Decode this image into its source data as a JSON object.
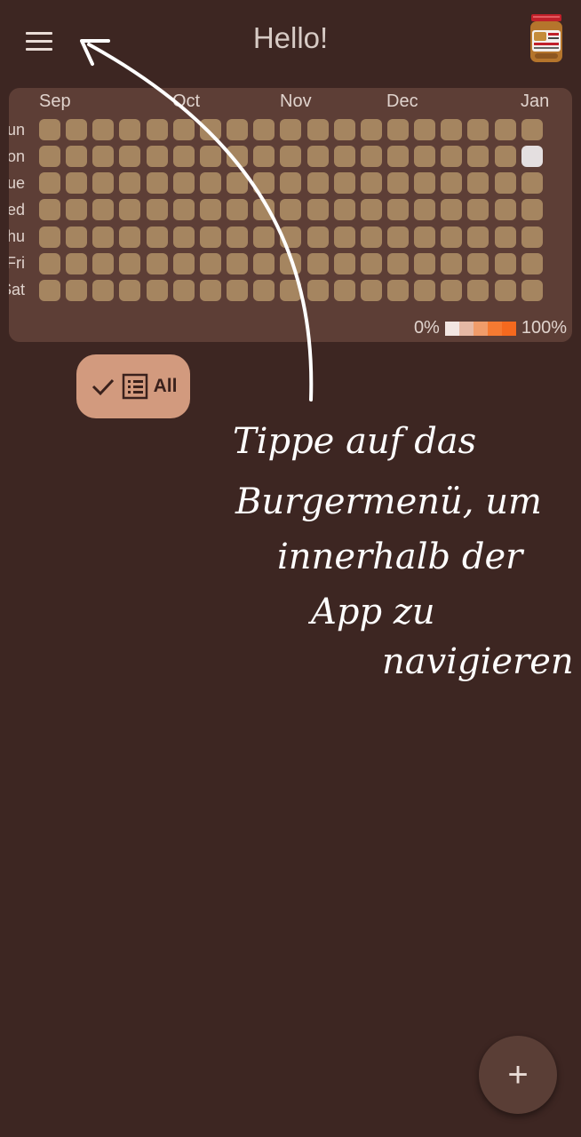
{
  "appbar": {
    "title": "Hello!",
    "menu_icon": "hamburger-menu-icon",
    "avatar_icon": "peanut-butter-jar-icon"
  },
  "heatmap": {
    "months": [
      "Sep",
      "Oct",
      "Nov",
      "Dec",
      "Jan"
    ],
    "weekdays": [
      "Sun",
      "Mon",
      "Tue",
      "Wed",
      "Thu",
      "Fri",
      "Sat"
    ],
    "highlighted_cell": {
      "weekday": "Mon",
      "month": "Jan"
    },
    "legend": {
      "min_label": "0%",
      "max_label": "100%",
      "scale_colors": [
        "#f2e6e2",
        "#e6b9a5",
        "#f09c6a",
        "#f57a32",
        "#f5691e"
      ]
    },
    "cell_color": "#a58560",
    "active_cell_color": "#e4dfe0"
  },
  "filter": {
    "label": "All",
    "check_icon": "check-icon",
    "list_icon": "list-icon"
  },
  "hint": {
    "lines": [
      "Tippe auf das",
      "Burgermenü, um",
      "innerhalb der",
      "App zu",
      "navigieren"
    ]
  },
  "fab": {
    "icon": "plus-icon",
    "label": "+"
  }
}
